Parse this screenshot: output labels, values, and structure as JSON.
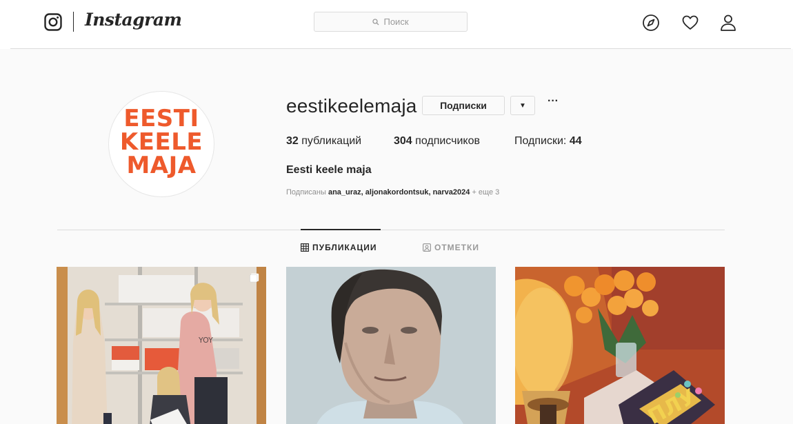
{
  "header": {
    "brand": "Instagram",
    "search_placeholder": "Поиск"
  },
  "icons": {
    "logo": "instagram-camera-icon",
    "explore": "compass-icon",
    "activity": "heart-icon",
    "profile": "person-icon",
    "search": "search-icon",
    "dropdown": "caret-down-icon",
    "more": "ellipsis-icon",
    "posts_tab": "grid-icon",
    "tagged_tab": "tag-portrait-icon",
    "multi_post": "multiple-photos-icon"
  },
  "profile": {
    "avatar_lines": [
      "EESTI",
      "KEELE",
      "MAJA"
    ],
    "username": "eestikeelemaja",
    "follow_button": "Подписки",
    "dropdown_glyph": "▼",
    "more_glyph": "···",
    "posts_count": "32",
    "posts_label": "публикаций",
    "followers_count": "304",
    "followers_label": "подписчиков",
    "following_label": "Подписки:",
    "following_count": "44",
    "full_name": "Eesti keele maja",
    "followed_by_prefix": "Подписаны",
    "followed_by_users": "ana_uraz, aljonakordontsuk, narva2024",
    "followed_by_more": "+ еще 3"
  },
  "tabs": [
    {
      "label": "ПУБЛИКАЦИИ",
      "active": true
    },
    {
      "label": "ОТМЕТКИ",
      "active": false
    }
  ],
  "colors": {
    "brand_orange": "#ee5a2c",
    "text": "#262626",
    "muted": "#8e8e8e",
    "border": "#dbdbdb",
    "background": "#fafafa"
  }
}
